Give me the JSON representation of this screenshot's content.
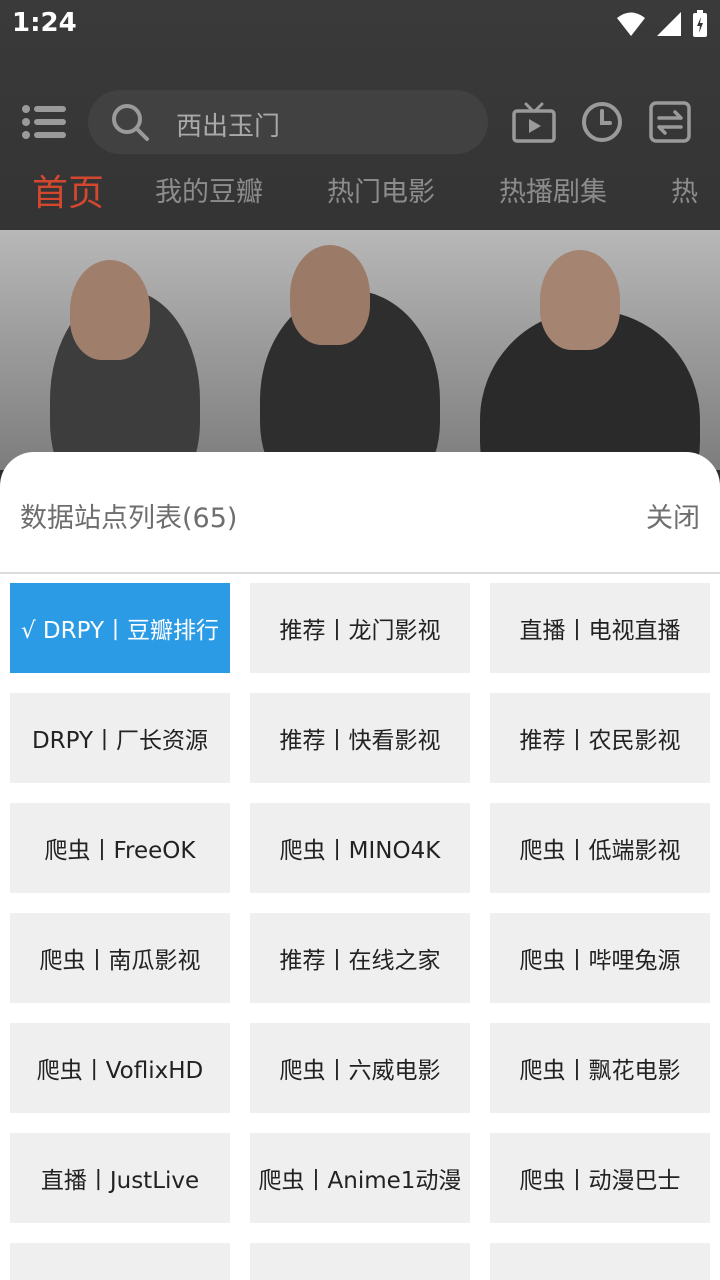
{
  "status_bar": {
    "time": "1:24",
    "icons": [
      "wifi-icon",
      "signal-icon",
      "battery-icon"
    ]
  },
  "toolbar": {
    "search_placeholder": "西出玉门",
    "icons": [
      "menu-icon",
      "search-icon",
      "tv-icon",
      "history-icon",
      "switch-icon"
    ]
  },
  "tabs": [
    "首页",
    "我的豆瓣",
    "热门电影",
    "热播剧集",
    "热"
  ],
  "active_tab": 0,
  "sheet": {
    "title": "数据站点列表(65)",
    "close_label": "关闭",
    "items": [
      "√ DRPY丨豆瓣排行",
      "推荐丨龙门影视",
      "直播丨电视直播",
      "DRPY丨厂长资源",
      "推荐丨快看影视",
      "推荐丨农民影视",
      "爬虫丨FreeOK",
      "爬虫丨MINO4K",
      "爬虫丨低端影视",
      "爬虫丨南瓜影视",
      "推荐丨在线之家",
      "爬虫丨哔哩兔源",
      "爬虫丨VoflixHD",
      "爬虫丨六威电影",
      "爬虫丨飘花电影",
      "直播丨JustLive",
      "爬虫丨Anime1动漫",
      "爬虫丨动漫巴士",
      "",
      "",
      ""
    ],
    "selected_index": 0
  },
  "colors": {
    "accent": "#2b9be6",
    "active_tab": "#d2472e",
    "cell_bg": "#efefef"
  }
}
